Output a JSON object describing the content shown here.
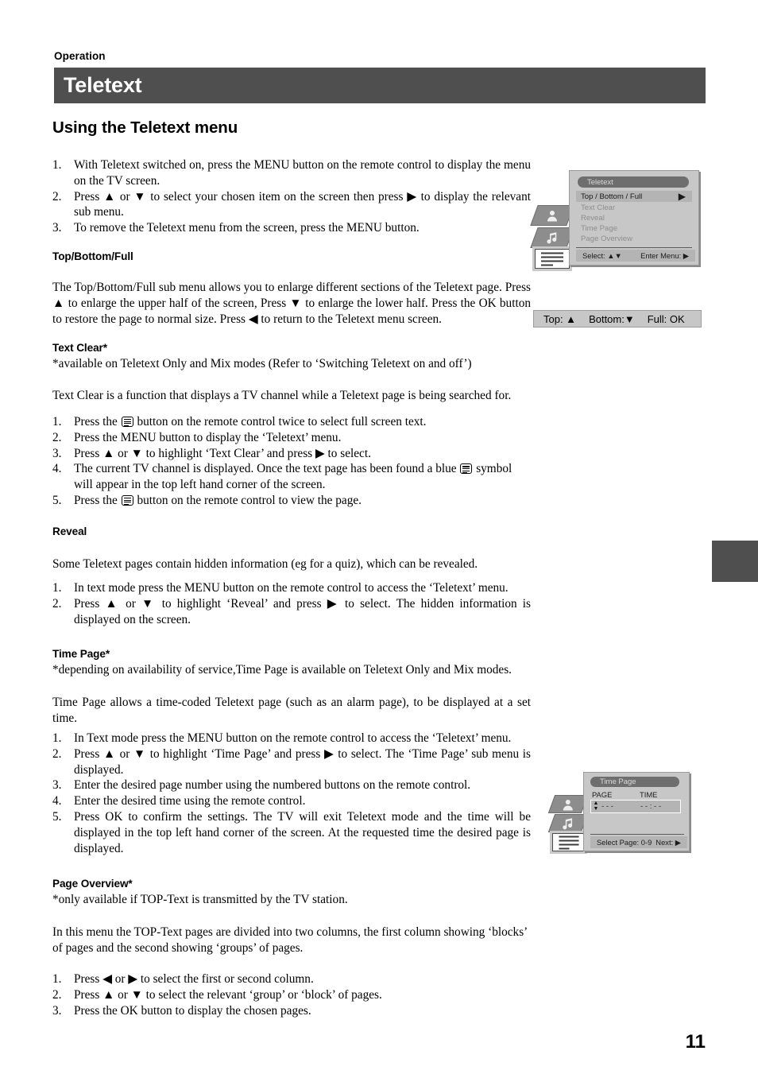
{
  "header": {
    "kicker": "Operation",
    "title": "Teletext",
    "section_heading": "Using the Teletext menu"
  },
  "page_number": "11",
  "colors": {
    "header_bar": "#4f4f4f",
    "osd_panel": "#c7c7c7",
    "osd_highlight": "#b4b4b4",
    "osd_pill": "#6e6e6e"
  },
  "intro_steps": [
    {
      "num": "1.",
      "text": "With Teletext switched on, press the MENU button on the remote control to display the menu on the TV screen."
    },
    {
      "num": "2.",
      "text_before": "Press ",
      "text": "Press ▲ or ▼ to select your chosen item on the screen then press ▶ to display the relevant sub menu."
    },
    {
      "num": "3.",
      "text": "To remove the Teletext menu from the screen, press the MENU button."
    }
  ],
  "sections": {
    "top_bottom_full": {
      "heading": "Top/Bottom/Full",
      "body": "The Top/Bottom/Full sub menu allows you to enlarge different sections of the Teletext page. Press ▲ to enlarge the upper half of the screen, Press ▼ to enlarge the lower half. Press the OK button to restore the page to normal size. Press ◀ to return to the Teletext menu screen."
    },
    "text_clear": {
      "heading": "Text Clear*",
      "footnote": "*available on Teletext Only and Mix modes (Refer to ‘Switching Teletext on and off’)",
      "body": "Text Clear is a function that displays a TV channel while a Teletext page is being searched for.",
      "steps": [
        {
          "num": "1.",
          "pre": "Press the ",
          "icon": "teletext-icon",
          "post": " button on the remote control twice to select full screen text."
        },
        {
          "num": "2.",
          "pre": "Press the MENU button to display the ‘Teletext’ menu.",
          "icon": "",
          "post": ""
        },
        {
          "num": "3.",
          "pre": "Press ▲ or ▼ to highlight ‘Text Clear’ and press ▶ to select.",
          "icon": "",
          "post": ""
        },
        {
          "num": "4.",
          "pre": "The current TV channel is displayed. Once the text page has been found a blue ",
          "icon": "teletext-icon",
          "post": " symbol will appear in the top left hand corner of the screen."
        },
        {
          "num": "5.",
          "pre": "Press the ",
          "icon": "teletext-icon",
          "post": " button on the remote control to view the page."
        }
      ]
    },
    "reveal": {
      "heading": "Reveal",
      "body": "Some Teletext pages contain hidden information (eg for a quiz), which can be revealed.",
      "steps": [
        {
          "num": "1.",
          "text": "In text mode press the MENU button on the remote control to access the ‘Teletext’ menu."
        },
        {
          "num": "2.",
          "text": "Press ▲ or ▼ to highlight ‘Reveal’ and press ▶ to select. The hidden information is displayed on the screen."
        }
      ]
    },
    "time_page": {
      "heading": "Time Page*",
      "footnote": "*depending on availability of service,Time Page is available on Teletext Only and Mix modes.",
      "body": "Time Page allows a time-coded Teletext page (such as an alarm page), to be displayed at a set time.",
      "steps": [
        {
          "num": "1.",
          "text": "In Text mode press the MENU button on the remote control to access the ‘Teletext’ menu."
        },
        {
          "num": "2.",
          "text": "Press ▲ or ▼ to highlight ‘Time Page’ and press ▶ to select. The ‘Time Page’ sub menu is displayed."
        },
        {
          "num": "3.",
          "text": "Enter the desired page number using the numbered buttons on the remote control."
        },
        {
          "num": "4.",
          "text": "Enter the desired time using the remote control."
        },
        {
          "num": "5.",
          "text": "Press OK to confirm the settings. The TV will exit Teletext mode and the time will be displayed in the top left hand corner of the screen. At the requested time the desired page is displayed."
        }
      ]
    },
    "page_overview": {
      "heading": "Page Overview*",
      "footnote": "*only available if TOP-Text is transmitted by the TV station.",
      "body": "In this menu the TOP-Text pages are divided into two columns, the first column showing ‘blocks’ of pages and the second showing ‘groups’ of pages.",
      "steps": [
        {
          "num": "1.",
          "text": "Press ◀ or ▶ to select the first or second column."
        },
        {
          "num": "2.",
          "text": "Press ▲ or ▼ to select the relevant ‘group’ or ‘block’ of pages."
        },
        {
          "num": "3.",
          "text": "Press the OK button to display the chosen pages."
        }
      ]
    }
  },
  "osd_teletext_menu": {
    "title": "Teletext",
    "items": [
      {
        "label": "Top / Bottom / Full",
        "state": "highlighted",
        "arrow": "▶"
      },
      {
        "label": "Text Clear",
        "state": "dim"
      },
      {
        "label": "Reveal",
        "state": "dim"
      },
      {
        "label": "Time  Page",
        "state": "dim"
      },
      {
        "label": "Page Overview",
        "state": "dim"
      }
    ],
    "footer_left": "Select: ▲▼",
    "footer_right": "Enter Menu: ▶",
    "tabs": [
      "picture-tab-icon",
      "sound-tab-icon",
      "text-tab-icon"
    ]
  },
  "osd_time_page": {
    "title": "Time  Page",
    "col_page": "PAGE",
    "col_time": "TIME",
    "page_value": "- - -",
    "time_value": "- - : - -",
    "footer_left": "Select Page: 0-9",
    "footer_right": "Next: ▶",
    "tabs": [
      "picture-tab-icon",
      "sound-tab-icon",
      "text-tab-icon"
    ]
  },
  "hint_bar": {
    "top": "Top: ▲",
    "bottom": "Bottom:▼",
    "full": "Full: OK"
  }
}
